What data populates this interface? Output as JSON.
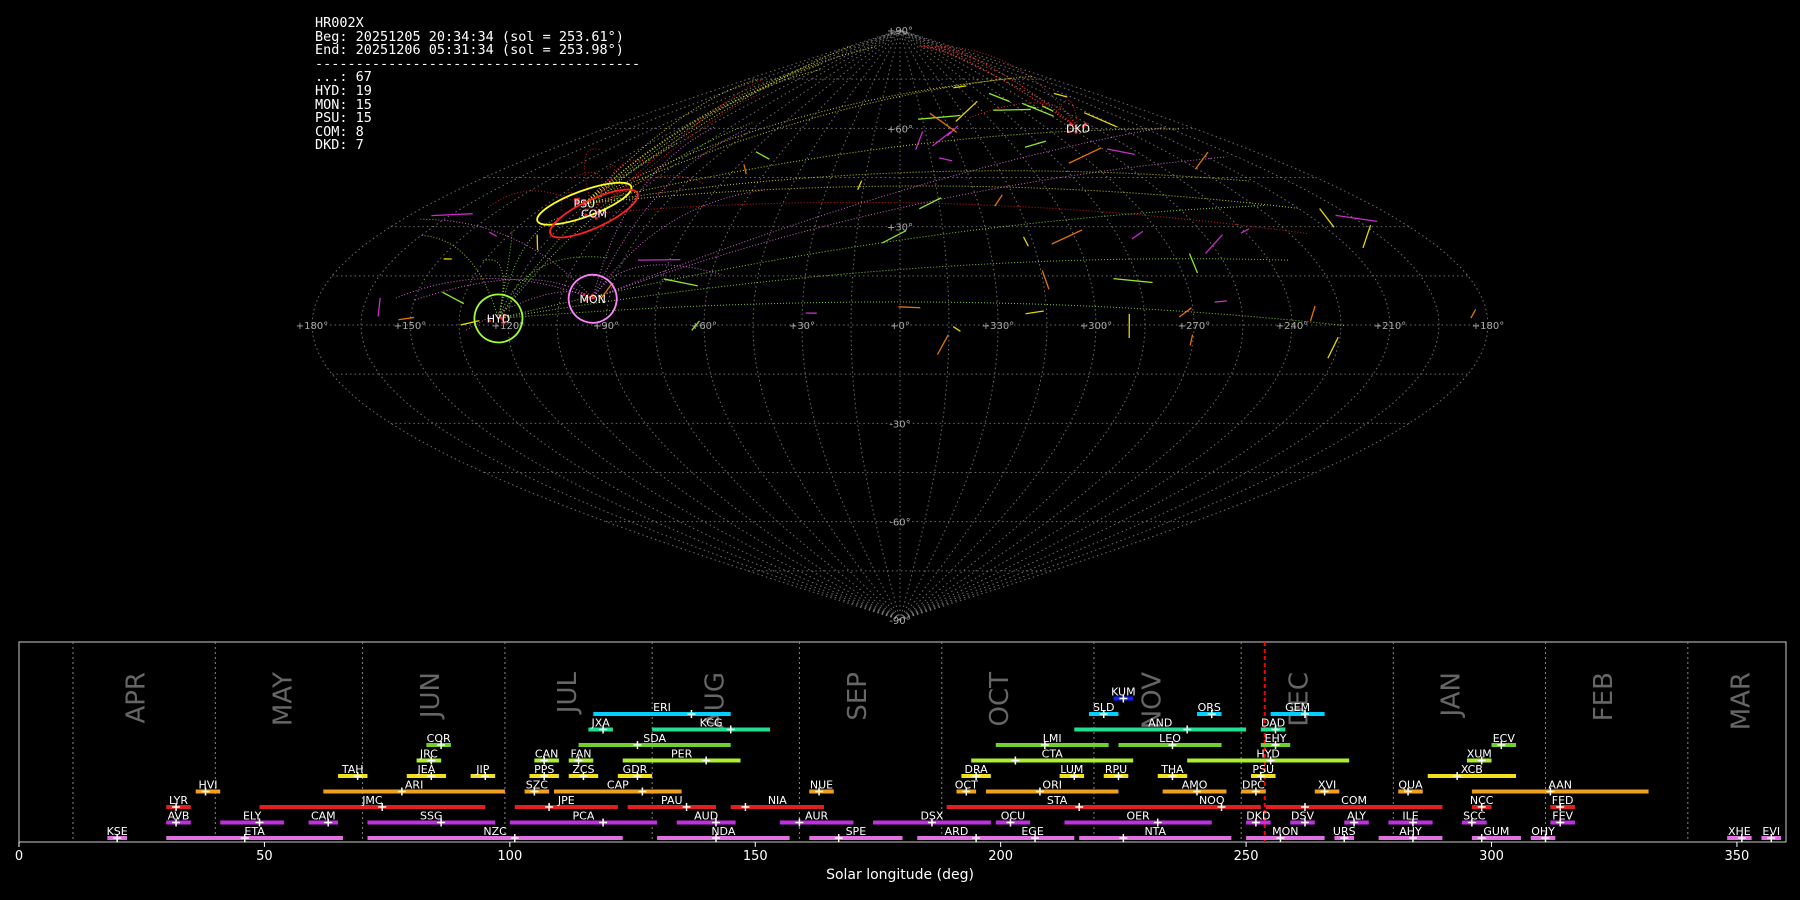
{
  "info": {
    "station": "HR002X",
    "beg": "Beg: 20251205 20:34:34 (sol = 253.61°)",
    "end": "End: 20251206 05:31:34 (sol = 253.98°)",
    "separator": "----------------------------------------",
    "counts": [
      {
        "code": "...",
        "n": 67
      },
      {
        "code": "HYD",
        "n": 19
      },
      {
        "code": "MON",
        "n": 15
      },
      {
        "code": "PSU",
        "n": 15
      },
      {
        "code": "COM",
        "n": 8
      },
      {
        "code": "DKD",
        "n": 7
      }
    ]
  },
  "sky": {
    "lon_labels": [
      "+180°",
      "+150°",
      "+120°",
      "+90°",
      "+60°",
      "+30°",
      "+0°",
      "+330°",
      "+300°",
      "+270°",
      "+240°",
      "+210°",
      "+180°"
    ],
    "lat_labels": [
      "+90°",
      "+60°",
      "+30°",
      "-30°",
      "-60°",
      "-90°"
    ],
    "radiants": [
      {
        "code": "PSU",
        "lon": 121,
        "lat": 37,
        "color": "#ffff20"
      },
      {
        "code": "COM",
        "lon": 113,
        "lat": 34,
        "color": "#ff2020"
      },
      {
        "code": "HYD",
        "lon": 123,
        "lat": 2,
        "color": "#a0ff30"
      },
      {
        "code": "MON",
        "lon": 95,
        "lat": 8,
        "color": "#ff80ff"
      },
      {
        "code": "DKD",
        "lon": 251,
        "lat": 60,
        "color": "#ff3030"
      }
    ],
    "colors": {
      "grid": "#888888",
      "sporadic": "#a0ff30",
      "magenta": "#dd33dd",
      "yellow": "#ffee00",
      "orange": "#ff8000"
    }
  },
  "chart_data": {
    "type": "timeline",
    "xlabel": "Solar longitude (deg)",
    "xlim": [
      0,
      360
    ],
    "xticks": [
      0,
      50,
      100,
      150,
      200,
      250,
      300,
      350
    ],
    "current_sol": 253.8,
    "months": [
      {
        "name": "APR",
        "sol": 24
      },
      {
        "name": "MAY",
        "sol": 54
      },
      {
        "name": "JUN",
        "sol": 84
      },
      {
        "name": "JUL",
        "sol": 112
      },
      {
        "name": "AUG",
        "sol": 142
      },
      {
        "name": "SEP",
        "sol": 171
      },
      {
        "name": "OCT",
        "sol": 200
      },
      {
        "name": "NOV",
        "sol": 231
      },
      {
        "name": "DEC",
        "sol": 261
      },
      {
        "name": "JAN",
        "sol": 292
      },
      {
        "name": "FEB",
        "sol": 323
      },
      {
        "name": "MAR",
        "sol": 351
      }
    ],
    "month_bounds": [
      11,
      40,
      70,
      99,
      129,
      159,
      188,
      219,
      249,
      280,
      311,
      340
    ],
    "showers": [
      {
        "code": "KUM",
        "start": 223,
        "end": 227,
        "peak": 225,
        "row": 10,
        "color": "#1020ff"
      },
      {
        "code": "ERI",
        "start": 117,
        "end": 145,
        "peak": 137,
        "row": 9,
        "color": "#00d0ff"
      },
      {
        "code": "SLD",
        "start": 218,
        "end": 224,
        "peak": 221,
        "row": 9,
        "color": "#00d0ff"
      },
      {
        "code": "ORS",
        "start": 240,
        "end": 245,
        "peak": 243,
        "row": 9,
        "color": "#00d0ff"
      },
      {
        "code": "GEM",
        "start": 255,
        "end": 266,
        "peak": 262,
        "row": 9,
        "color": "#00d0ff"
      },
      {
        "code": "JXA",
        "start": 116,
        "end": 121,
        "peak": 119,
        "row": 8,
        "color": "#20e090"
      },
      {
        "code": "KCG",
        "start": 129,
        "end": 153,
        "peak": 145,
        "row": 8,
        "color": "#20e090"
      },
      {
        "code": "AND",
        "start": 215,
        "end": 250,
        "peak": 238,
        "row": 8,
        "color": "#20e090"
      },
      {
        "code": "DAD",
        "start": 253,
        "end": 258,
        "peak": 256,
        "row": 8,
        "color": "#20e090"
      },
      {
        "code": "COR",
        "start": 83,
        "end": 88,
        "peak": 86,
        "row": 7,
        "color": "#70d030"
      },
      {
        "code": "SDA",
        "start": 114,
        "end": 145,
        "peak": 126,
        "row": 7,
        "color": "#70d030"
      },
      {
        "code": "LMI",
        "start": 199,
        "end": 222,
        "peak": 209,
        "row": 7,
        "color": "#70d030"
      },
      {
        "code": "LEO",
        "start": 224,
        "end": 245,
        "peak": 235,
        "row": 7,
        "color": "#70d030"
      },
      {
        "code": "EHY",
        "start": 253,
        "end": 259,
        "peak": 256,
        "row": 7,
        "color": "#70d030"
      },
      {
        "code": "ECV",
        "start": 300,
        "end": 305,
        "peak": 302,
        "row": 7,
        "color": "#70d030"
      },
      {
        "code": "JRC",
        "start": 81,
        "end": 86,
        "peak": 84,
        "row": 6,
        "color": "#a8f030"
      },
      {
        "code": "CAN",
        "start": 105,
        "end": 110,
        "peak": 107,
        "row": 6,
        "color": "#a8f030"
      },
      {
        "code": "FAN",
        "start": 112,
        "end": 117,
        "peak": 114,
        "row": 6,
        "color": "#a8f030"
      },
      {
        "code": "PER",
        "start": 123,
        "end": 147,
        "peak": 140,
        "row": 6,
        "color": "#a8f030"
      },
      {
        "code": "CTA",
        "start": 194,
        "end": 227,
        "peak": 203,
        "row": 6,
        "color": "#a8f030"
      },
      {
        "code": "HYD",
        "start": 238,
        "end": 271,
        "peak": 255,
        "row": 6,
        "color": "#a8f030"
      },
      {
        "code": "XUM",
        "start": 295,
        "end": 300,
        "peak": 298,
        "row": 6,
        "color": "#a8f030"
      },
      {
        "code": "TAH",
        "start": 65,
        "end": 71,
        "peak": 69,
        "row": 5,
        "color": "#f0e020"
      },
      {
        "code": "JEA",
        "start": 79,
        "end": 87,
        "peak": 84,
        "row": 5,
        "color": "#f0e020"
      },
      {
        "code": "JIP",
        "start": 92,
        "end": 97,
        "peak": 95,
        "row": 5,
        "color": "#f0e020"
      },
      {
        "code": "PPS",
        "start": 104,
        "end": 110,
        "peak": 107,
        "row": 5,
        "color": "#f0e020"
      },
      {
        "code": "ZCS",
        "start": 112,
        "end": 118,
        "peak": 115,
        "row": 5,
        "color": "#f0e020"
      },
      {
        "code": "GDR",
        "start": 122,
        "end": 129,
        "peak": 126,
        "row": 5,
        "color": "#f0e020"
      },
      {
        "code": "DRA",
        "start": 192,
        "end": 198,
        "peak": 195,
        "row": 5,
        "color": "#f0e020"
      },
      {
        "code": "LUM",
        "start": 212,
        "end": 217,
        "peak": 215,
        "row": 5,
        "color": "#f0e020"
      },
      {
        "code": "RPU",
        "start": 221,
        "end": 226,
        "peak": 224,
        "row": 5,
        "color": "#f0e020"
      },
      {
        "code": "THA",
        "start": 232,
        "end": 238,
        "peak": 235,
        "row": 5,
        "color": "#f0e020"
      },
      {
        "code": "PSU",
        "start": 251,
        "end": 256,
        "peak": 253,
        "row": 5,
        "color": "#f0e020"
      },
      {
        "code": "XCB",
        "start": 287,
        "end": 305,
        "peak": 293,
        "row": 5,
        "color": "#f0e020"
      },
      {
        "code": "HVI",
        "start": 36,
        "end": 41,
        "peak": 38,
        "row": 4,
        "color": "#f0a020"
      },
      {
        "code": "ARI",
        "start": 62,
        "end": 99,
        "peak": 78,
        "row": 4,
        "color": "#f0a020"
      },
      {
        "code": "SZC",
        "start": 103,
        "end": 108,
        "peak": 105,
        "row": 4,
        "color": "#f0a020"
      },
      {
        "code": "CAP",
        "start": 109,
        "end": 135,
        "peak": 127,
        "row": 4,
        "color": "#f0a020"
      },
      {
        "code": "NUE",
        "start": 161,
        "end": 166,
        "peak": 163,
        "row": 4,
        "color": "#f0a020"
      },
      {
        "code": "OCT",
        "start": 191,
        "end": 195,
        "peak": 193,
        "row": 4,
        "color": "#f0a020"
      },
      {
        "code": "ORI",
        "start": 197,
        "end": 224,
        "peak": 208,
        "row": 4,
        "color": "#f0a020"
      },
      {
        "code": "AMO",
        "start": 233,
        "end": 246,
        "peak": 240,
        "row": 4,
        "color": "#f0a020"
      },
      {
        "code": "DPC",
        "start": 249,
        "end": 254,
        "peak": 252,
        "row": 4,
        "color": "#f0a020"
      },
      {
        "code": "XVI",
        "start": 264,
        "end": 269,
        "peak": 266,
        "row": 4,
        "color": "#f0a020"
      },
      {
        "code": "QUA",
        "start": 281,
        "end": 286,
        "peak": 283,
        "row": 4,
        "color": "#f0a020"
      },
      {
        "code": "AAN",
        "start": 296,
        "end": 332,
        "peak": 312,
        "row": 4,
        "color": "#f0a020"
      },
      {
        "code": "LYR",
        "start": 30,
        "end": 35,
        "peak": 32,
        "row": 3,
        "color": "#e02020"
      },
      {
        "code": "JMC",
        "start": 49,
        "end": 95,
        "peak": 74,
        "row": 3,
        "color": "#e02020"
      },
      {
        "code": "JPE",
        "start": 101,
        "end": 122,
        "peak": 108,
        "row": 3,
        "color": "#e02020"
      },
      {
        "code": "PAU",
        "start": 124,
        "end": 142,
        "peak": 136,
        "row": 3,
        "color": "#e02020"
      },
      {
        "code": "NIA",
        "start": 145,
        "end": 164,
        "peak": 148,
        "row": 3,
        "color": "#e02020"
      },
      {
        "code": "STA",
        "start": 189,
        "end": 234,
        "peak": 216,
        "row": 3,
        "color": "#e02020"
      },
      {
        "code": "NOO",
        "start": 233,
        "end": 253,
        "peak": 245,
        "row": 3,
        "color": "#e02020"
      },
      {
        "code": "COM",
        "start": 254,
        "end": 290,
        "peak": 262,
        "row": 3,
        "color": "#e02020"
      },
      {
        "code": "NCC",
        "start": 296,
        "end": 300,
        "peak": 298,
        "row": 3,
        "color": "#e02020"
      },
      {
        "code": "FED",
        "start": 312,
        "end": 317,
        "peak": 314,
        "row": 3,
        "color": "#e02020"
      },
      {
        "code": "AVB",
        "start": 30,
        "end": 35,
        "peak": 32,
        "row": 2,
        "color": "#c030e0"
      },
      {
        "code": "ELY",
        "start": 41,
        "end": 54,
        "peak": 49,
        "row": 2,
        "color": "#c030e0"
      },
      {
        "code": "CAM",
        "start": 59,
        "end": 65,
        "peak": 63,
        "row": 2,
        "color": "#c030e0"
      },
      {
        "code": "SSG",
        "start": 71,
        "end": 97,
        "peak": 86,
        "row": 2,
        "color": "#c030e0"
      },
      {
        "code": "PCA",
        "start": 100,
        "end": 130,
        "peak": 119,
        "row": 2,
        "color": "#c030e0"
      },
      {
        "code": "AUD",
        "start": 134,
        "end": 146,
        "peak": 142,
        "row": 2,
        "color": "#c030e0"
      },
      {
        "code": "AUR",
        "start": 155,
        "end": 170,
        "peak": 159,
        "row": 2,
        "color": "#c030e0"
      },
      {
        "code": "DSX",
        "start": 174,
        "end": 198,
        "peak": 186,
        "row": 2,
        "color": "#c030e0"
      },
      {
        "code": "OCU",
        "start": 199,
        "end": 206,
        "peak": 202,
        "row": 2,
        "color": "#c030e0"
      },
      {
        "code": "OER",
        "start": 213,
        "end": 243,
        "peak": 232,
        "row": 2,
        "color": "#c030e0"
      },
      {
        "code": "DKD",
        "start": 250,
        "end": 255,
        "peak": 252,
        "row": 2,
        "color": "#c030e0"
      },
      {
        "code": "DSV",
        "start": 259,
        "end": 264,
        "peak": 262,
        "row": 2,
        "color": "#c030e0"
      },
      {
        "code": "ALY",
        "start": 270,
        "end": 275,
        "peak": 272,
        "row": 2,
        "color": "#c030e0"
      },
      {
        "code": "ILE",
        "start": 279,
        "end": 288,
        "peak": 284,
        "row": 2,
        "color": "#c030e0"
      },
      {
        "code": "SCC",
        "start": 294,
        "end": 299,
        "peak": 296,
        "row": 2,
        "color": "#c030e0"
      },
      {
        "code": "FEV",
        "start": 312,
        "end": 317,
        "peak": 314,
        "row": 2,
        "color": "#c030e0"
      },
      {
        "code": "KSE",
        "start": 18,
        "end": 22,
        "peak": 20,
        "row": 1,
        "color": "#e070e0"
      },
      {
        "code": "ETA",
        "start": 30,
        "end": 66,
        "peak": 46,
        "row": 1,
        "color": "#e070e0"
      },
      {
        "code": "NZC",
        "start": 71,
        "end": 123,
        "peak": 101,
        "row": 1,
        "color": "#e070e0"
      },
      {
        "code": "NDA",
        "start": 130,
        "end": 157,
        "peak": 142,
        "row": 1,
        "color": "#e070e0"
      },
      {
        "code": "SPE",
        "start": 161,
        "end": 180,
        "peak": 167,
        "row": 1,
        "color": "#e070e0"
      },
      {
        "code": "ARD",
        "start": 183,
        "end": 199,
        "peak": 195,
        "row": 1,
        "color": "#e070e0"
      },
      {
        "code": "EGE",
        "start": 198,
        "end": 215,
        "peak": 207,
        "row": 1,
        "color": "#e070e0"
      },
      {
        "code": "NTA",
        "start": 216,
        "end": 247,
        "peak": 225,
        "row": 1,
        "color": "#e070e0"
      },
      {
        "code": "MON",
        "start": 250,
        "end": 266,
        "peak": 257,
        "row": 1,
        "color": "#e070e0"
      },
      {
        "code": "URS",
        "start": 268,
        "end": 272,
        "peak": 270,
        "row": 1,
        "color": "#e070e0"
      },
      {
        "code": "AHY",
        "start": 277,
        "end": 290,
        "peak": 284,
        "row": 1,
        "color": "#e070e0"
      },
      {
        "code": "GUM",
        "start": 296,
        "end": 306,
        "peak": 298,
        "row": 1,
        "color": "#e070e0"
      },
      {
        "code": "OHY",
        "start": 308,
        "end": 313,
        "peak": 311,
        "row": 1,
        "color": "#e070e0"
      },
      {
        "code": "XHE",
        "start": 348,
        "end": 353,
        "peak": 351,
        "row": 1,
        "color": "#e070e0"
      },
      {
        "code": "EVI",
        "start": 355,
        "end": 359,
        "peak": 357,
        "row": 1,
        "color": "#e070e0"
      }
    ]
  }
}
